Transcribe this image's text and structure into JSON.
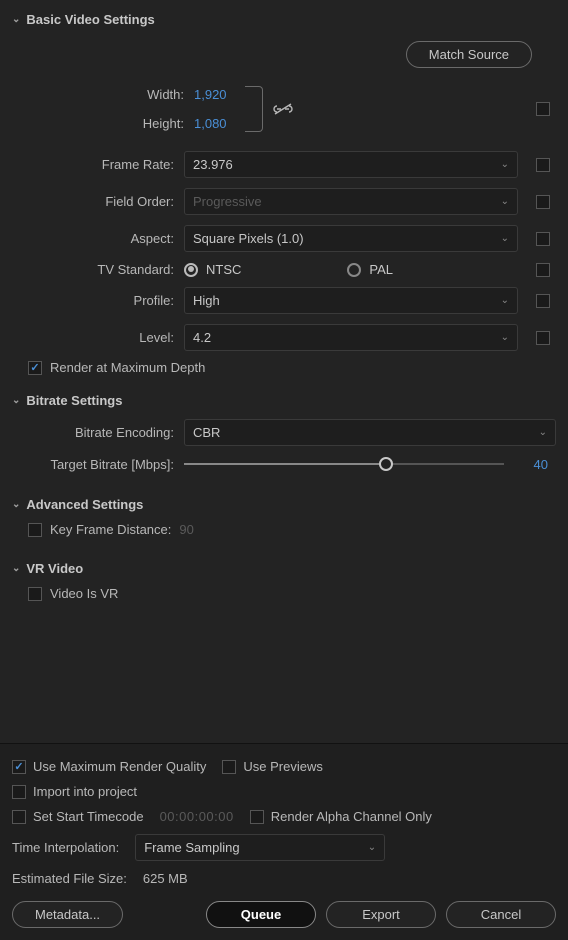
{
  "basicVideo": {
    "title": "Basic Video Settings",
    "matchSource": "Match Source",
    "widthLabel": "Width:",
    "widthValue": "1,920",
    "heightLabel": "Height:",
    "heightValue": "1,080",
    "frameRateLabel": "Frame Rate:",
    "frameRateValue": "23.976",
    "fieldOrderLabel": "Field Order:",
    "fieldOrderValue": "Progressive",
    "aspectLabel": "Aspect:",
    "aspectValue": "Square Pixels (1.0)",
    "tvStandardLabel": "TV Standard:",
    "tvNtsc": "NTSC",
    "tvPal": "PAL",
    "profileLabel": "Profile:",
    "profileValue": "High",
    "levelLabel": "Level:",
    "levelValue": "4.2",
    "renderMaxDepth": "Render at Maximum Depth"
  },
  "bitrate": {
    "title": "Bitrate Settings",
    "encodingLabel": "Bitrate Encoding:",
    "encodingValue": "CBR",
    "targetLabel": "Target Bitrate [Mbps]:",
    "targetValue": "40",
    "targetPercent": 63
  },
  "advanced": {
    "title": "Advanced Settings",
    "keyFrameLabel": "Key Frame Distance:",
    "keyFrameValue": "90"
  },
  "vr": {
    "title": "VR Video",
    "isVr": "Video Is VR"
  },
  "bottom": {
    "maxQuality": "Use Maximum Render Quality",
    "usePreviews": "Use Previews",
    "importProject": "Import into project",
    "startTimecode": "Set Start Timecode",
    "timecodeValue": "00:00:00:00",
    "alphaOnly": "Render Alpha Channel Only",
    "timeInterpLabel": "Time Interpolation:",
    "timeInterpValue": "Frame Sampling",
    "estSizeLabel": "Estimated File Size:",
    "estSizeValue": "625 MB",
    "metadata": "Metadata...",
    "queue": "Queue",
    "export": "Export",
    "cancel": "Cancel"
  }
}
